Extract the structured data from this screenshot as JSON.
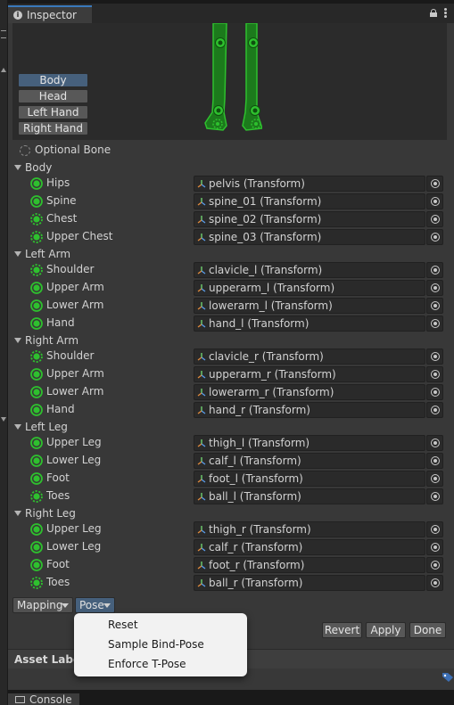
{
  "inspector": {
    "tab_title": "Inspector",
    "icons": [
      "info-icon",
      "lock-icon",
      "kebab-menu-icon"
    ]
  },
  "body_buttons": [
    "Body",
    "Head",
    "Left Hand",
    "Right Hand"
  ],
  "optional_bone_label": "Optional Bone",
  "colors": {
    "bone_green": "#2ec02e",
    "active_button": "#46607c",
    "background": "#383838"
  },
  "groups": [
    {
      "name": "Body",
      "bones": [
        {
          "label": "Hips",
          "value": "pelvis (Transform)",
          "required": true
        },
        {
          "label": "Spine",
          "value": "spine_01 (Transform)",
          "required": true
        },
        {
          "label": "Chest",
          "value": "spine_02 (Transform)",
          "required": false
        },
        {
          "label": "Upper Chest",
          "value": "spine_03 (Transform)",
          "required": false
        }
      ]
    },
    {
      "name": "Left Arm",
      "bones": [
        {
          "label": "Shoulder",
          "value": "clavicle_l (Transform)",
          "required": false
        },
        {
          "label": "Upper Arm",
          "value": "upperarm_l (Transform)",
          "required": true
        },
        {
          "label": "Lower Arm",
          "value": "lowerarm_l (Transform)",
          "required": true
        },
        {
          "label": "Hand",
          "value": "hand_l (Transform)",
          "required": true
        }
      ]
    },
    {
      "name": "Right Arm",
      "bones": [
        {
          "label": "Shoulder",
          "value": "clavicle_r (Transform)",
          "required": false
        },
        {
          "label": "Upper Arm",
          "value": "upperarm_r (Transform)",
          "required": true
        },
        {
          "label": "Lower Arm",
          "value": "lowerarm_r (Transform)",
          "required": true
        },
        {
          "label": "Hand",
          "value": "hand_r (Transform)",
          "required": true
        }
      ]
    },
    {
      "name": "Left Leg",
      "bones": [
        {
          "label": "Upper Leg",
          "value": "thigh_l (Transform)",
          "required": true
        },
        {
          "label": "Lower Leg",
          "value": "calf_l (Transform)",
          "required": true
        },
        {
          "label": "Foot",
          "value": "foot_l (Transform)",
          "required": true
        },
        {
          "label": "Toes",
          "value": "ball_l (Transform)",
          "required": false
        }
      ]
    },
    {
      "name": "Right Leg",
      "bones": [
        {
          "label": "Upper Leg",
          "value": "thigh_r (Transform)",
          "required": true
        },
        {
          "label": "Lower Leg",
          "value": "calf_r (Transform)",
          "required": true
        },
        {
          "label": "Foot",
          "value": "foot_r (Transform)",
          "required": true
        },
        {
          "label": "Toes",
          "value": "ball_r (Transform)",
          "required": false
        }
      ]
    }
  ],
  "bottom_bar": {
    "mapping_label": "Mapping",
    "pose_label": "Pose"
  },
  "actions": {
    "revert": "Revert",
    "apply": "Apply",
    "done": "Done"
  },
  "pose_menu": [
    "Reset",
    "Sample Bind-Pose",
    "Enforce T-Pose"
  ],
  "asset_labels_title": "Asset Labe",
  "console_tab": "Console"
}
